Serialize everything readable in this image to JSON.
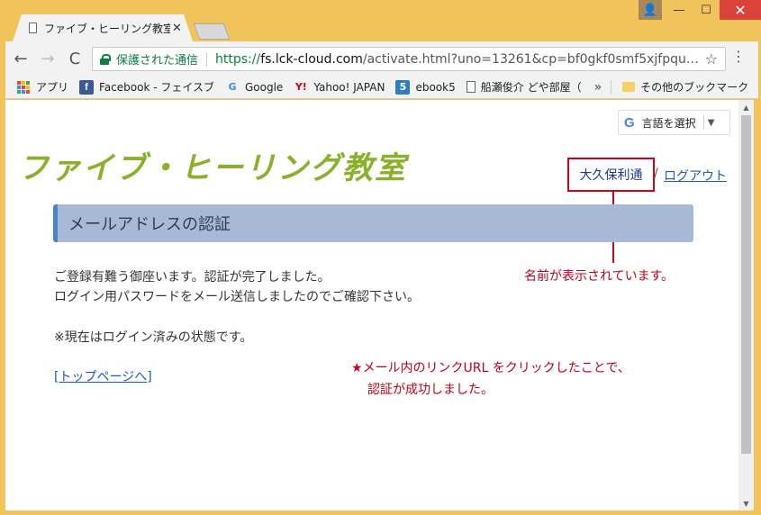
{
  "window": {
    "controls": {
      "profile": "👤",
      "minimize": "—",
      "maximize": "☐",
      "close": "✕"
    }
  },
  "tab": {
    "title": "ファイブ・ヒーリング教室 (",
    "close_label": "✕"
  },
  "toolbar": {
    "back": "←",
    "forward": "→",
    "reload": "C",
    "secure_label": "保護された通信",
    "url_scheme": "https://",
    "url_host": "fs.lck-cloud.com",
    "url_path": "/activate.html?uno=13261&cp=bf0gkf0smf5xjfpqu…",
    "star": "☆",
    "menu": "⋮"
  },
  "bookmarks": {
    "items": [
      {
        "label": "アプリ",
        "icon": "apps-grid-icon"
      },
      {
        "label": "Facebook - フェイスブ",
        "icon": "facebook-icon",
        "glyph": "f"
      },
      {
        "label": "Google",
        "icon": "google-icon",
        "glyph": "G"
      },
      {
        "label": "Yahoo! JAPAN",
        "icon": "yahoo-icon",
        "glyph": "Y!"
      },
      {
        "label": "ebook5",
        "icon": "ebook5-icon",
        "glyph": "5"
      },
      {
        "label": "船瀬俊介 どや部屋（",
        "icon": "page-icon"
      }
    ],
    "overflow": "»",
    "other_label": "その他のブックマーク"
  },
  "page": {
    "translate_label": "言語を選択",
    "translate_g": "G",
    "translate_arrow": "▼",
    "site_title": "ファイブ・ヒーリング教室",
    "user_name": "大久保利通",
    "user_sep": "/",
    "logout_label": "ログアウト",
    "section_title": "メールアドレスの認証",
    "message_line1": "ご登録有難う御座います。認証が完了しました。",
    "message_line2": "ログイン用パスワードをメール送信しましたのでご確認下さい。",
    "message_line3": "※現在はログイン済みの状態です。",
    "top_link_open": "[",
    "top_link_label": "トップページへ",
    "top_link_close": "]",
    "annotation_name": "名前が表示されています。",
    "annotation_star": "★",
    "annotation_line1": "メール内のリンクURL をクリックしたことで、",
    "annotation_line2": "認証が成功しました。"
  },
  "scrollbar": {
    "up": "▲",
    "down": "▼"
  },
  "colors": {
    "frame": "#f1c35b",
    "title_green": "#8ab12c",
    "header_blue": "#a8b9d6",
    "annotation_red": "#c0001b",
    "link_blue": "#1a5bbf"
  }
}
